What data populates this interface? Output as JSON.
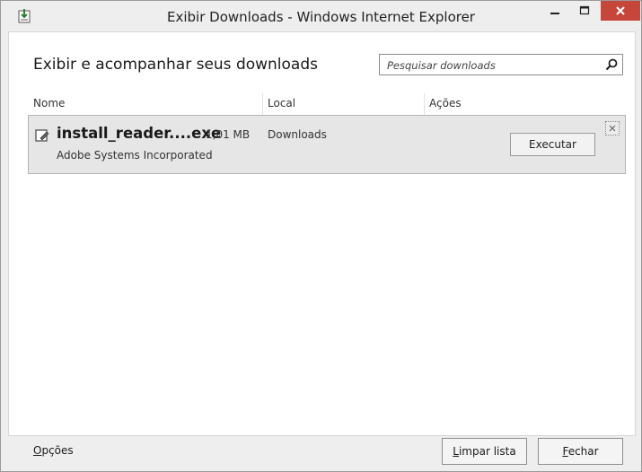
{
  "window": {
    "title": "Exibir Downloads - Windows Internet Explorer",
    "icon": "download-manager-icon",
    "controls": {
      "minimize": "minimize-icon",
      "maximize": "maximize-icon",
      "close": "close-icon"
    },
    "close_color": "#c7463c"
  },
  "header": {
    "heading": "Exibir e acompanhar seus downloads",
    "search": {
      "placeholder": "Pesquisar downloads",
      "value": "",
      "icon": "search-icon"
    }
  },
  "columns": [
    "Nome",
    "Local",
    "Ações"
  ],
  "downloads": [
    {
      "name": "install_reader....exe",
      "size": "1,01 MB",
      "publisher": "Adobe Systems Incorporated",
      "location": "Downloads",
      "action": "Executar",
      "icon": "file-icon"
    }
  ],
  "footer": {
    "options": {
      "accel": "O",
      "rest": "pções"
    },
    "clear": {
      "accel": "L",
      "rest": "impar lista"
    },
    "close": {
      "accel": "F",
      "rest": "echar"
    }
  }
}
